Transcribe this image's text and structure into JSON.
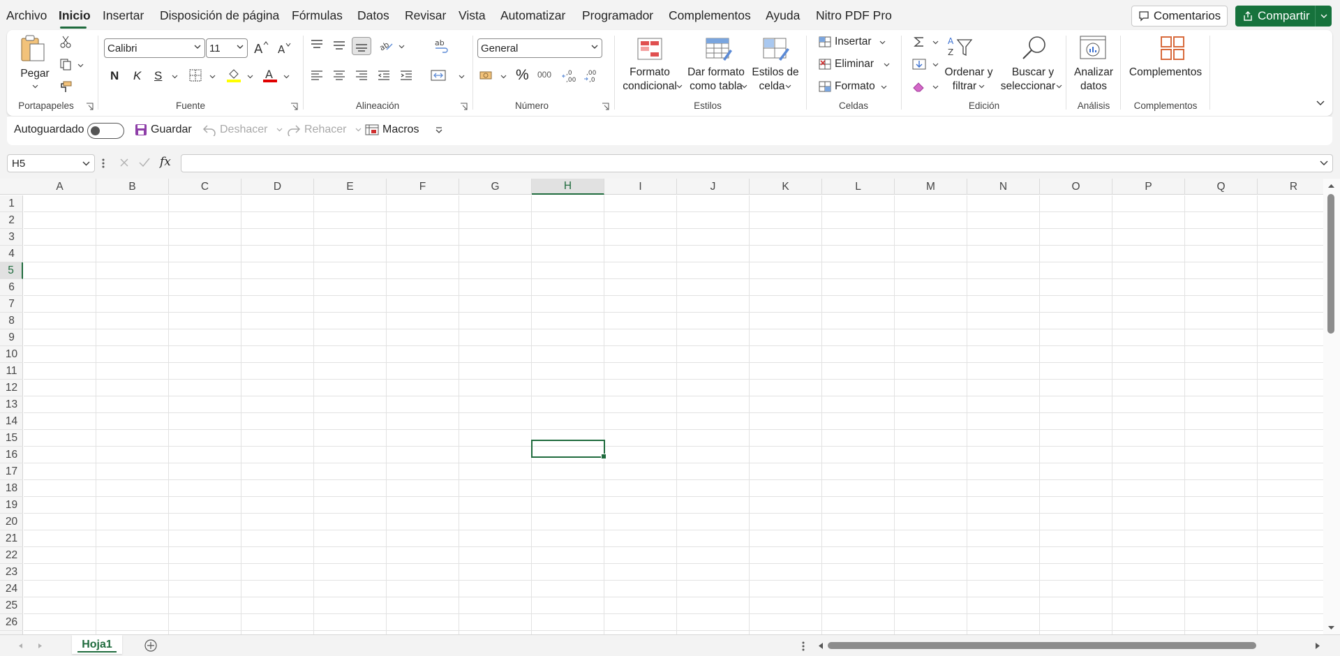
{
  "menu": {
    "items": [
      "Archivo",
      "Inicio",
      "Insertar",
      "Disposición de página",
      "Fórmulas",
      "Datos",
      "Revisar",
      "Vista",
      "Automatizar",
      "Programador",
      "Complementos",
      "Ayuda",
      "Nitro PDF Pro"
    ],
    "active": "Inicio",
    "comments_label": "Comentarios",
    "share_label": "Compartir"
  },
  "ribbon": {
    "clipboard": {
      "paste_label": "Pegar",
      "group_label": "Portapapeles"
    },
    "font": {
      "font_name": "Calibri",
      "font_size": "11",
      "bold": "N",
      "italic": "K",
      "strike": "S",
      "group_label": "Fuente"
    },
    "alignment": {
      "group_label": "Alineación"
    },
    "number": {
      "format": "General",
      "percent": "%",
      "thousands": "000",
      "group_label": "Número"
    },
    "styles": {
      "conditional_line1": "Formato",
      "conditional_line2": "condicional",
      "table_line1": "Dar formato",
      "table_line2": "como tabla",
      "cell_styles_line1": "Estilos de",
      "cell_styles_line2": "celda",
      "group_label": "Estilos"
    },
    "cells": {
      "insert": "Insertar",
      "delete": "Eliminar",
      "format": "Formato",
      "group_label": "Celdas"
    },
    "editing": {
      "sort_line1": "Ordenar y",
      "sort_line2": "filtrar",
      "find_line1": "Buscar y",
      "find_line2": "seleccionar",
      "group_label": "Edición"
    },
    "analysis": {
      "analyze_line1": "Analizar",
      "analyze_line2": "datos",
      "group_label": "Análisis"
    },
    "addins": {
      "label": "Complementos",
      "group_label": "Complementos"
    }
  },
  "qat": {
    "autosave": "Autoguardado",
    "save": "Guardar",
    "undo": "Deshacer",
    "redo": "Rehacer",
    "macros": "Macros"
  },
  "formula_bar": {
    "name_box": "H5",
    "fx": "fx",
    "value": ""
  },
  "grid": {
    "columns": [
      "A",
      "B",
      "C",
      "D",
      "E",
      "F",
      "G",
      "H",
      "I",
      "J",
      "K",
      "L",
      "M",
      "N",
      "O",
      "P",
      "Q",
      "R"
    ],
    "rows": [
      "1",
      "2",
      "3",
      "4",
      "5",
      "6",
      "7",
      "8",
      "9",
      "10",
      "11",
      "12",
      "13",
      "14",
      "15",
      "16",
      "17",
      "18",
      "19",
      "20",
      "21",
      "22",
      "23",
      "24",
      "25",
      "26"
    ],
    "selected_column": "H",
    "selected_row": "5"
  },
  "sheets": {
    "tabs": [
      "Hoja1"
    ],
    "active": "Hoja1"
  },
  "colors": {
    "accent": "#1f6b3d",
    "share_bg": "#16723c",
    "fill_yellow": "#ffff00",
    "font_red": "#e00000"
  }
}
